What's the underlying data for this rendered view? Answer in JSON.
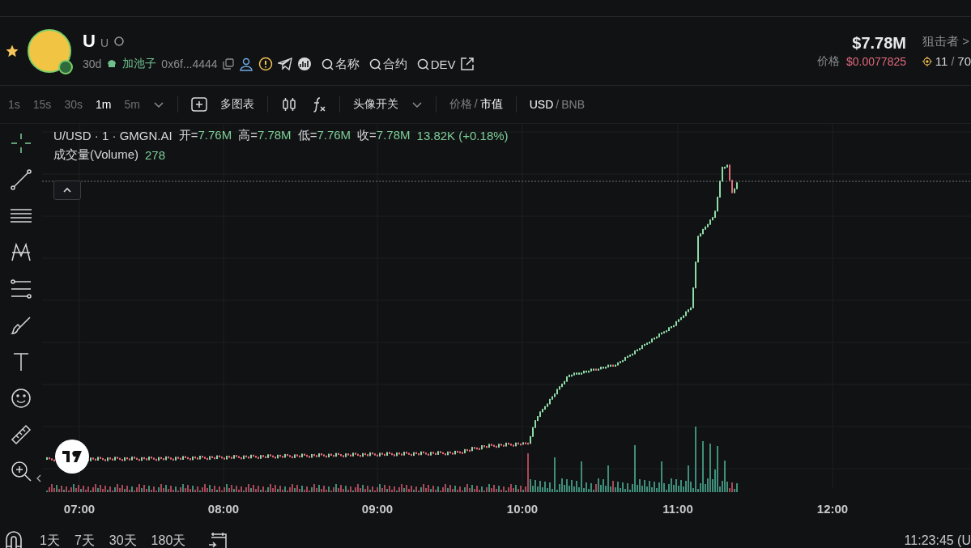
{
  "token": {
    "name": "U",
    "symbol": "U",
    "age": "30d",
    "pool": "加池子",
    "address": "0x6f...4444",
    "search_links": [
      "名称",
      "合约",
      "DEV"
    ],
    "market_cap": "$7.78M",
    "price_label": "价格",
    "price": "$0.0077825",
    "snipers_label": "狙击者 >",
    "snipers_count": "11",
    "snipers_separator": "/",
    "snipers_total": "70"
  },
  "toolbar": {
    "intervals": [
      {
        "label": "1s",
        "selected": false
      },
      {
        "label": "15s",
        "selected": false
      },
      {
        "label": "30s",
        "selected": false
      },
      {
        "label": "1m",
        "selected": true
      },
      {
        "label": "5m",
        "selected": false
      }
    ],
    "multi_chart": "多图表",
    "avatar_toggle": "头像开关",
    "mode_separator": "/",
    "currency_separator": "/",
    "price_modes": [
      {
        "label": "价格",
        "selected": false
      },
      {
        "label": "市值",
        "selected": true
      }
    ],
    "currencies": [
      {
        "label": "USD",
        "selected": true
      },
      {
        "label": "BNB",
        "selected": false
      }
    ]
  },
  "legend": {
    "title": "U/USD · 1 · GMGN.AI",
    "ohlc": [
      {
        "label": "开=",
        "value": "7.76M"
      },
      {
        "label": "高=",
        "value": "7.78M"
      },
      {
        "label": "低=",
        "value": "7.76M"
      },
      {
        "label": "收=",
        "value": "7.78M"
      }
    ],
    "change": "13.82K (+0.18%)",
    "volume_label": "成交量(Volume)",
    "volume_value": "278"
  },
  "x_ticks": [
    "07:00",
    "08:00",
    "09:00",
    "10:00",
    "11:00",
    "12:00"
  ],
  "ranges": [
    "1天",
    "7天",
    "30天",
    "180天"
  ],
  "clock": "11:23:45 (U"
}
